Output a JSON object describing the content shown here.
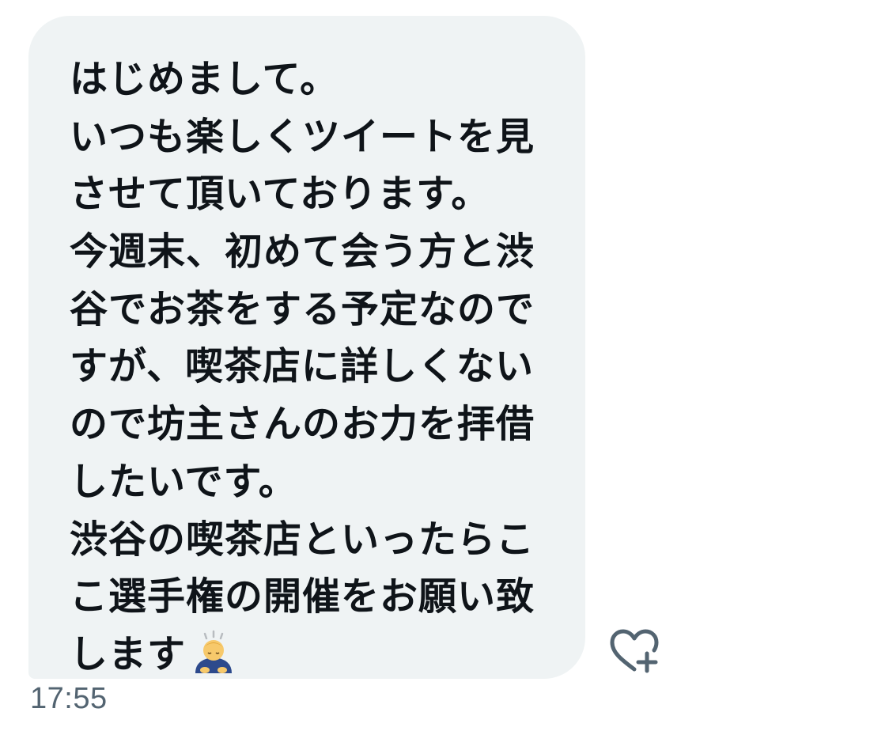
{
  "message": {
    "lines": [
      "はじめまして。",
      "いつも楽しくツイートを見",
      "させて頂いております。",
      "今週末、初めて会う方と渋",
      "谷でお茶をする予定なので",
      "すが、喫茶店に詳しくない",
      "ので坊主さんのお力を拝借",
      "したいです。",
      "渋谷の喫茶店といったらこ",
      "こ選手権の開催をお願い致",
      "します"
    ],
    "emoji": "person-bowing-emoji",
    "timestamp": "17:55"
  },
  "actions": {
    "react_icon": "heart-plus-icon"
  },
  "colors": {
    "bubble": "#eff3f4",
    "text": "#0f1419",
    "timestamp": "#536471",
    "icon": "#536471"
  }
}
